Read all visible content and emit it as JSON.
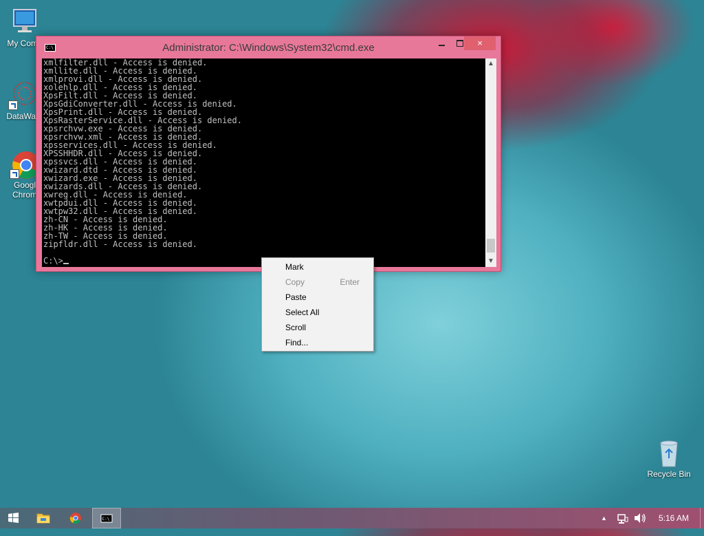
{
  "desktop": {
    "icons": [
      {
        "label": "My Comp",
        "icon": "computer-icon"
      },
      {
        "label": "DataWag",
        "icon": "datawag-icon"
      },
      {
        "label_line1": "Googl",
        "label_line2": "Chrom",
        "icon": "chrome-icon"
      }
    ],
    "recycle_bin": {
      "label": "Recycle Bin",
      "icon": "recycle-bin-icon"
    }
  },
  "cmd_window": {
    "title": "Administrator:  C:\\Windows\\System32\\cmd.exe",
    "controls": {
      "minimize": "minimize-icon",
      "maximize": "maximize-icon",
      "close": "×"
    },
    "lines": [
      "xmlfilter.dll - Access is denied.",
      "xmllite.dll - Access is denied.",
      "xmlprovi.dll - Access is denied.",
      "xolehlp.dll - Access is denied.",
      "XpsFilt.dll - Access is denied.",
      "XpsGdiConverter.dll - Access is denied.",
      "XpsPrint.dll - Access is denied.",
      "XpsRasterService.dll - Access is denied.",
      "xpsrchvw.exe - Access is denied.",
      "xpsrchvw.xml - Access is denied.",
      "xpsservices.dll - Access is denied.",
      "XPSSHHDR.dll - Access is denied.",
      "xpssvcs.dll - Access is denied.",
      "xwizard.dtd - Access is denied.",
      "xwizard.exe - Access is denied.",
      "xwizards.dll - Access is denied.",
      "xwreg.dll - Access is denied.",
      "xwtpdui.dll - Access is denied.",
      "xwtpw32.dll - Access is denied.",
      "zh-CN - Access is denied.",
      "zh-HK - Access is denied.",
      "zh-TW - Access is denied.",
      "zipfldr.dll - Access is denied."
    ],
    "prompt": "C:\\>",
    "scrollbar": {
      "up": "▲",
      "down": "▼"
    }
  },
  "context_menu": {
    "items": [
      {
        "label": "Mark",
        "enabled": true
      },
      {
        "label": "Copy",
        "shortcut": "Enter",
        "enabled": false
      },
      {
        "label": "Paste",
        "enabled": true
      },
      {
        "label": "Select All",
        "enabled": true
      },
      {
        "label": "Scroll",
        "enabled": true
      },
      {
        "label": "Find...",
        "enabled": true
      }
    ]
  },
  "taskbar": {
    "buttons": [
      "start-icon",
      "file-explorer-icon",
      "chrome-icon",
      "cmd-icon"
    ],
    "tray": {
      "overflow": "▲",
      "clock": "5:16 AM"
    }
  }
}
